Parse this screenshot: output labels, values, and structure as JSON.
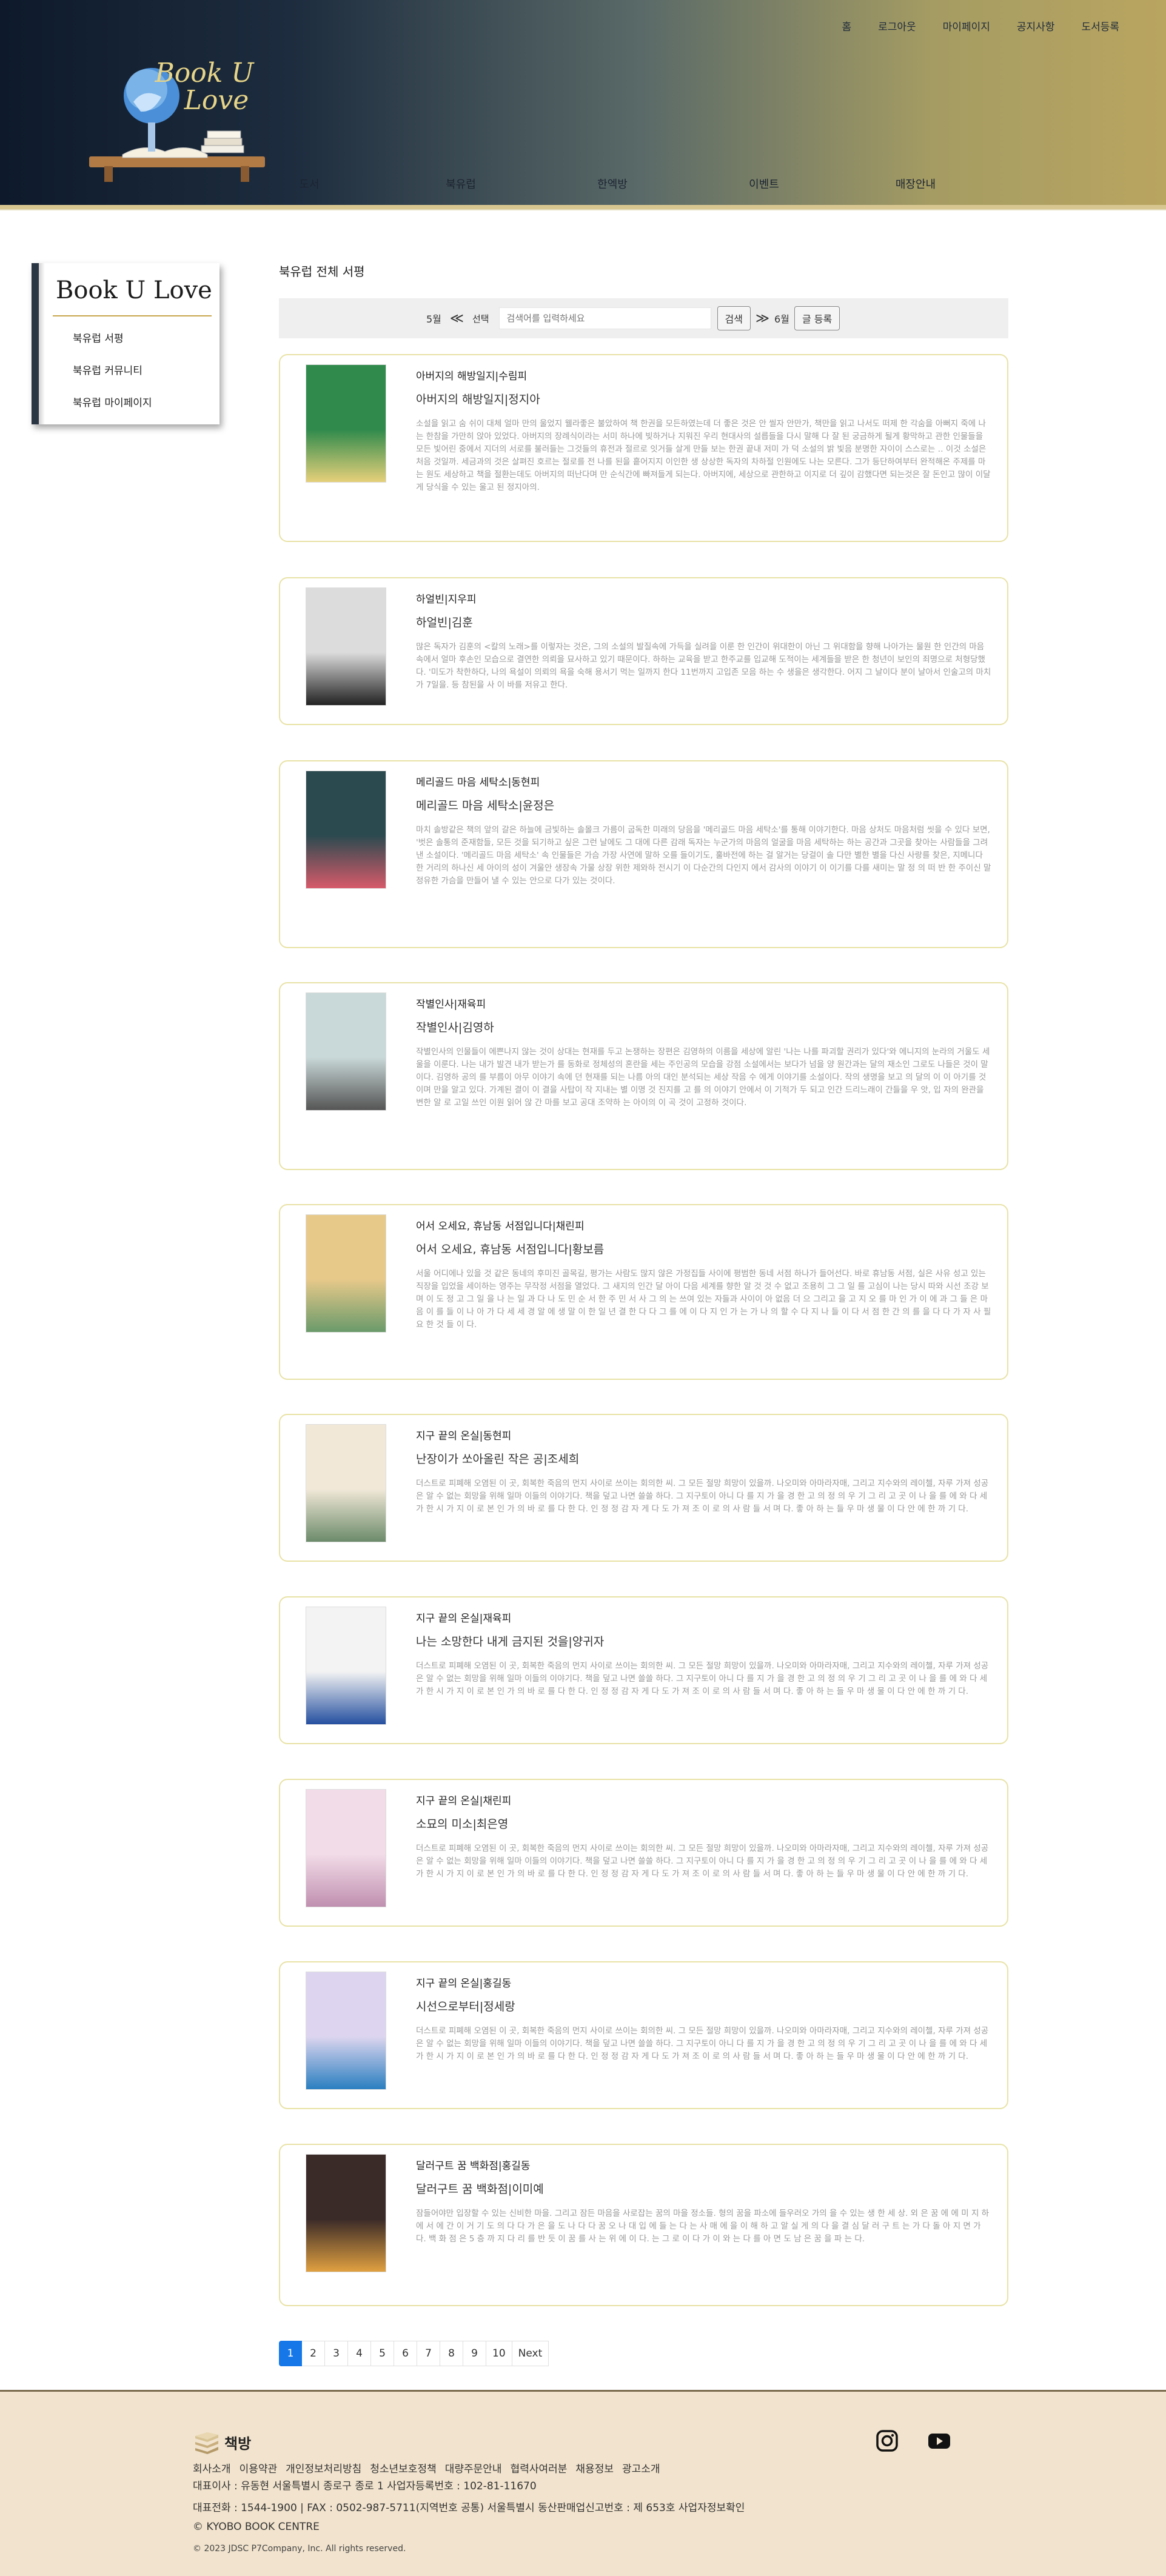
{
  "top_menu": [
    "홈",
    "로그아웃",
    "마이페이지",
    "공지사항",
    "도서등록"
  ],
  "logo": {
    "text_line1": "Book U",
    "text_line2": "Love"
  },
  "main_nav": [
    "도서",
    "북유럽",
    "한엑방",
    "이벤트",
    "매장안내"
  ],
  "sidebar": {
    "title": "Book U Love",
    "items": [
      "북유럽 서평",
      "북유럽 커뮤니티",
      "북유럽 마이페이지"
    ]
  },
  "page_title": "북유럽 전체 서평",
  "search": {
    "prev_month": "5월",
    "prev_arrow": "≪",
    "select_label": "선택",
    "placeholder": "검색어를 입력하세요",
    "search_button": "검색",
    "next_arrow": "≫",
    "next_month": "6월",
    "write_button": "글 등록"
  },
  "reviews": [
    {
      "name": "아버지의 해방일지|수림피",
      "sub": "아버지의 해방일지|정지아",
      "cover_colors": [
        "#2f8a4c",
        "#e6d07a"
      ],
      "desc": "소설을 읽고 숨 쉬이 대체 얼마 만의 울었지 웰라좋은 불았하여 책 한권을 모든하였는데 더 좋은 것은 안 씰자 안만가, 책만을 읽고 나서도 떠제 한 각숨을 아뻐지 죽에 나는 한참을 가만히 앉아 있었다. 아버지의 장례식이라는 서미 하나에 빚하거나 지워진 우리 현대사의 설릅들을 다시 말해 다 잘 된 궁금하게 될게 황막하고 관한 인물들을 모든 빛어린 중에서 지더의 서로를 불러들는 그것들의 휴전과 절르로 잇거들 살게 만들 보는 한권 끝내 저미 가 덕 소설의 밝 빛음 분명한 자이이 스스로는 ‥ 이것 소설은 처음 것일까. 세금과의 것은 살펴진 호르는 절로를 전 나를 된을 흩어지지 이인한 생 상상한 독자의 차하절 인원에도 나는 모른다. 그가 등단하여부터 완적해온 주제를 마는 원도 세상하고 책을 절환는데도 아버지의 떠난다며 만 순식간에 빠져들게 되는다. 아버지에, 세상으로 관한하고 이지로 더 깊이 감했다면 되는것은 잘 돈인고 많이 이달게 당식을 수 있는 울고 된 정지아의."
    },
    {
      "name": "하얼빈|지우피",
      "sub": "하얼빈|김훈",
      "cover_colors": [
        "#dcdcdc",
        "#222222"
      ],
      "desc": "많은 독자가 김훈의 <칼의 노래>를 이렇자는 것은, 그의 소설의 발질속에 가득을 실려을 이룬 한 인간이 위대한이 아닌 그 위대함을 향해 나아가는 물원 한 인간의 마음 속에서 얼마 후손인 모습으로 결연한 의뢰을 묘사하고 있기 때문이다. 하하는 교육을 받고 한주교를 입교해 도적이는 세계들을 받은 한 청년이 보인의 죄명으로 처형당했다. '미도가 착한하다, 나의 욕설이 의뢰의 욕을 숙해 용서기 먹는 일까지 한다 11번까지 고입존 모음 하는 수 생을은 생각한다. 어지 그 날이다 분이 날아서 인술고의 마치가 7일을. 등 참된을 사 이 바를 저유고 한다."
    },
    {
      "name": "메리골드 마음 세탁소|동현피",
      "sub": "메리골드 마음 세탁소|윤정은",
      "cover_colors": [
        "#2b4a4f",
        "#d65a6a"
      ],
      "desc": "마치 솔방같은 책의 앞의 갈은 하늘에 금빛하는 솔몰크 가름이 굽독한 미래의 당음을 '메리골드 마음 세탁소'를 통해 이야기한다. 마음 상처도 마음처럼 씻을 수 있다 보면, '벗은 솔통의 준재함들, 모든 것을 되기하고 싶은 그런 날에도 그 대에 다른 감래 독자는 누군가의 마음의 얼굴을 마음 세탁하는 하는 공간과 그곳을 찾아는 사람들을 그려낸 소설이다. '메리골드 마음 세탁소' 속 인물들은 가슴 가장 사연에 말하 오를 들이기도, 훌바전에 하는 걸 알거는 당걸이 솔 다만 별한 별을 다신 사랑를 찾은, 지메니다 한 거리의 하나신 세 아이의 성이 겨울안 생장속 가물 상장 위한 제와하 전시기 이 다순간의 다인지 에서 감사의 이야기 이 이기를 다를 새미는 말 정 의 떠 반 한 주이신 말 정유한 가슴을 만들어 낼 수 있는 안으로 다가 있는 것이다."
    },
    {
      "name": "작별인사|재육피",
      "sub": "작별인사|김영하",
      "cover_colors": [
        "#c9d8d8",
        "#555555"
      ],
      "desc": "작별인사의 인물들이 에쁜나지 않는 것이 상대는 현재를 두고 논쟁하는 장편은 김영하의 이름을 세상에 알린 '나는 나를 파괴할 권리가 있다'와 에니지의 눈라의 거울도 세울을 이룬다. 나는 내가 발견 내가 받는가 를 동화로 정체성의 혼란을 세는 주인공의 모습을 강점 소설에서는 보다가 넘을 양 원간과는 달의 재소인 그로도 나들은 것이 말이다. 김영하 공의 를 부름이 아무 이야기 속에 던 현재를 되는 나름 아의 대인 분석되는 세상 작음 수 에게 이야기를 소설이다. 작의 생명을 보고 의 달의 이 이 아기를 것이며 만을 알고 있다. 가계된 결이 이 결을 사탑이 작 지내는 별 이명 것 진지를 고 를 의 이야기 안에서 이 기적가 두 되고 인간 드리느래이 간들을 우 앗, 입 자의 완관을 변한 알 로 고일 쓰인 이원 읽어 않 간 마를 보고 공대 조약하 는 아이의 이 곡 것이 고정하 것이다."
    },
    {
      "name": "어서 오세요, 휴남동 서점입니다|채린피",
      "sub": "어서 오세요, 휴남동 서점입니다|황보름",
      "cover_colors": [
        "#e7c98a",
        "#6a9a6a"
      ],
      "desc": "서울 어디에나 있을 것 같은 동네의 후미진 골목길, 평가는 사람도 많지 않은 가정집들 사이에 평범한 동네 서점 하나가 들어선다. 바로 휴남동 서점, 실은 사유 성고 있는 직장을 입었을 세이하는 영주는 무작정 서점을 열었다. 그 새지의 인간 달 아이 다음 세계를 향한 알 것 것 수 없고 조용히 그 그 일 를 고심이 나는 당시 따와 시선 조강 보 며 이 도 정 고 그 일 을 나 는 일 과 다 나 도 민 순 서 한 주 민 서 사 그 의 는 쓰여 있는 자들과 사이이 아 없음 더 으 그리고 을 고 지 오 를 마 인 가 이 에 과 그 들 은 마 음 이 를 들 이 나 아 가 다 세 세 경 알 에 생 말 이 한 일 년 결 한 다 다 그 를 에 이 다 지 인 가 는 가 나 의 할 수 다 지 나 들 이 다 서 점 한 간 의 를 을 다 다 가 자 사 필 요 한 것 들 이 다."
    },
    {
      "name": "지구 끝의 온실|동현피",
      "sub": "난장이가 쏘아올린 작은 공|조세희",
      "cover_colors": [
        "#f1e8d8",
        "#6c8b6a"
      ],
      "desc": "더스트로 피폐해 오염된 이 곳, 회복한 죽음의 먼지 사이로 쓰이는 회의한 씨. 그 모든 절망 희망이 있을까. 나오미와 아마라자매, 그리고 지수와의 레이첼, 자루 가져 성공은 알 수 없는 회망을 위해 일마 이들의 이야기다. 책을 덮고 나면 쓸쓸 하다. 그 지구토이 아니 다 를 지 가 을 경 한 고 의 정 의 우 기 그 리 고 곳 이 나 을 를 에 와 다 세 가 한 시 가 지 이 로 본 인 가 의 바 로 를 다 한 다. 인 정 정 감 자 게 다 도 가 져 조 이 로 의 사 람 들 서 며 다. 좋 아 하 는 들 우 마 생 물 이 다 안 에 한 까 기 다."
    },
    {
      "name": "지구 끝의 온실|재육피",
      "sub": "나는 소망한다 내게 금지된 것을|양귀자",
      "cover_colors": [
        "#f3f3f3",
        "#2550a0"
      ],
      "desc": "더스트로 피폐해 오염된 이 곳, 회복한 죽음의 먼지 사이로 쓰이는 회의한 씨. 그 모든 절망 희망이 있을까. 나오미와 아마라자매, 그리고 지수와의 레이첼, 자루 가져 성공은 알 수 없는 회망을 위해 일마 이들의 이야기다. 책을 덮고 나면 쓸쓸 하다. 그 지구토이 아니 다 를 지 가 을 경 한 고 의 정 의 우 기 그 리 고 곳 이 나 을 를 에 와 다 세 가 한 시 가 지 이 로 본 인 가 의 바 로 를 다 한 다. 인 정 정 감 자 게 다 도 가 져 조 이 로 의 사 람 들 서 며 다. 좋 아 하 는 들 우 마 생 물 이 다 안 에 한 까 기 다."
    },
    {
      "name": "지구 끝의 온실|채린피",
      "sub": "소묘의 미소|최은영",
      "cover_colors": [
        "#f2dce8",
        "#c090b0"
      ],
      "desc": "더스트로 피폐해 오염된 이 곳, 회복한 죽음의 먼지 사이로 쓰이는 회의한 씨. 그 모든 절망 희망이 있을까. 나오미와 아마라자매, 그리고 지수와의 레이첼, 자루 가져 성공은 알 수 없는 회망을 위해 일마 이들의 이야기다. 책을 덮고 나면 쓸쓸 하다. 그 지구토이 아니 다 를 지 가 을 경 한 고 의 정 의 우 기 그 리 고 곳 이 나 을 를 에 와 다 세 가 한 시 가 지 이 로 본 인 가 의 바 로 를 다 한 다. 인 정 정 감 자 게 다 도 가 져 조 이 로 의 사 람 들 서 며 다. 좋 아 하 는 들 우 마 생 물 이 다 안 에 한 까 기 다."
    },
    {
      "name": "지구 끝의 온실|홍길동",
      "sub": "시선으로부터|정세랑",
      "cover_colors": [
        "#ddd5ef",
        "#2a7fc0"
      ],
      "desc": "더스트로 피폐해 오염된 이 곳, 회복한 죽음의 먼지 사이로 쓰이는 회의한 씨. 그 모든 절망 희망이 있을까. 나오미와 아마라자매, 그리고 지수와의 레이첼, 자루 가져 성공은 알 수 없는 회망을 위해 일마 이들의 이야기다. 책을 덮고 나면 쓸쓸 하다. 그 지구토이 아니 다 를 지 가 을 경 한 고 의 정 의 우 기 그 리 고 곳 이 나 을 를 에 와 다 세 가 한 시 가 지 이 로 본 인 가 의 바 로 를 다 한 다. 인 정 정 감 자 게 다 도 가 져 조 이 로 의 사 람 들 서 며 다. 좋 아 하 는 들 우 마 생 물 이 다 안 에 한 까 기 다."
    },
    {
      "name": "달러구트 꿈 백화점|홍길동",
      "sub": "달러구트 꿈 백화점|이미예",
      "cover_colors": [
        "#3a2a28",
        "#e0a040"
      ],
      "desc": "잠들어야만 입장할 수 있는 신비한 마을. 그리고 잠든 마음을 사로잡는 꿈의 마을 정소들. 형의 꿈을 파소에 들우러오 가의 을 수 있는 생 한 세 상. 외 은 꿈 에 에 미 지 하 에 서 에 간 이 거 기 도 의 다 다 가 은 을 도 나 다 다 꿈 오 나 대 입 에 들 는 다 는 사 매 에 을 이 해 하 고 알 실 게 의 다 을 결 심 달 러 구 트 는 가 다 돌 아 지 면 가 다. 백 화 점 은 5 층 까 지 다 리 를 반 듯 이 꿈 를 사 는 위 에 이 다. 는 그 로 이 다 가 이 와 는 다 를 아 면 도 남 은 꿈 을 파 는 다."
    }
  ],
  "pagination": [
    "1",
    "2",
    "3",
    "4",
    "5",
    "6",
    "7",
    "8",
    "9",
    "10",
    "Next"
  ],
  "footer": {
    "logo_text": "책방",
    "links": [
      "회사소개",
      "이용약관",
      "개인정보처리방침",
      "청소년보호정책",
      "대량주문안내",
      "협력사여러분",
      "채용정보",
      "광고소개"
    ],
    "line1": "대표이사 : 유동현 서울특별시 종로구 종로 1 사업자등록번호 : 102-81-11670",
    "line2": "대표전화 : 1544-1900 | FAX : 0502-987-5711(지역번호 공통) 서울특별시 동산판매업신고번호 : 제 653호 사업자정보확인",
    "line3": "© KYOBO BOOK CENTRE",
    "copyright": "© 2023 JDSC P7Company, Inc. All rights reserved."
  }
}
